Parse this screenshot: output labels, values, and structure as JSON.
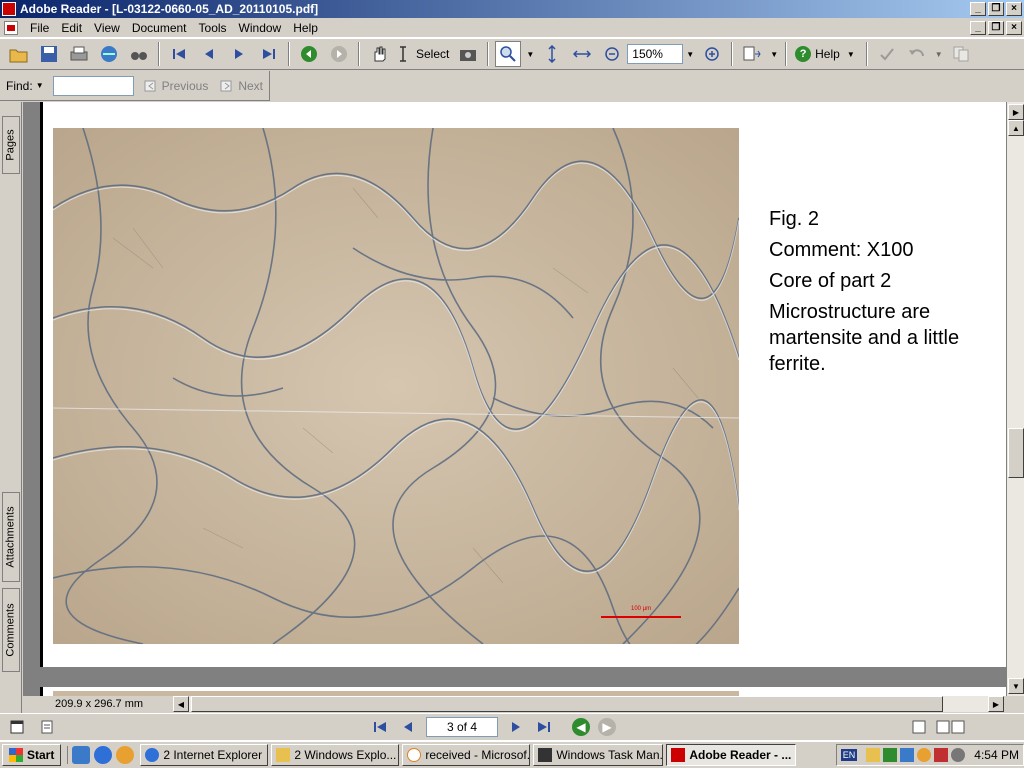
{
  "window": {
    "title": "Adobe Reader - [L-03122-0660-05_AD_20110105.pdf]"
  },
  "menu": {
    "items": [
      "File",
      "Edit",
      "View",
      "Document",
      "Tools",
      "Window",
      "Help"
    ]
  },
  "toolbar": {
    "select_label": "Select",
    "zoom_value": "150%",
    "help_label": "Help"
  },
  "findbar": {
    "find_label": "Find:",
    "previous_label": "Previous",
    "next_label": "Next"
  },
  "sidetabs": [
    "Pages",
    "Attachments",
    "Comments"
  ],
  "document": {
    "caption": {
      "fig": "Fig. 2",
      "comment": "Comment: X100",
      "core": "Core of part 2",
      "micro": "Microstructure are martensite and a little ferrite."
    },
    "scale_text": "100 µm"
  },
  "status": {
    "page_size": "209.9 x 296.7 mm",
    "page_indicator": "3 of 4"
  },
  "taskbar": {
    "start_label": "Start",
    "tasks": [
      "2 Internet Explorer",
      "2 Windows Explo...",
      "received - Microsof...",
      "Windows Task Man...",
      "Adobe Reader - ..."
    ],
    "lang": "EN",
    "clock": "4:54 PM"
  },
  "colors": {
    "titlebar_start": "#0a246a",
    "titlebar_end": "#a6caf0",
    "sample_base": "#c9b7a0",
    "scale_bar": "#dd0000"
  }
}
